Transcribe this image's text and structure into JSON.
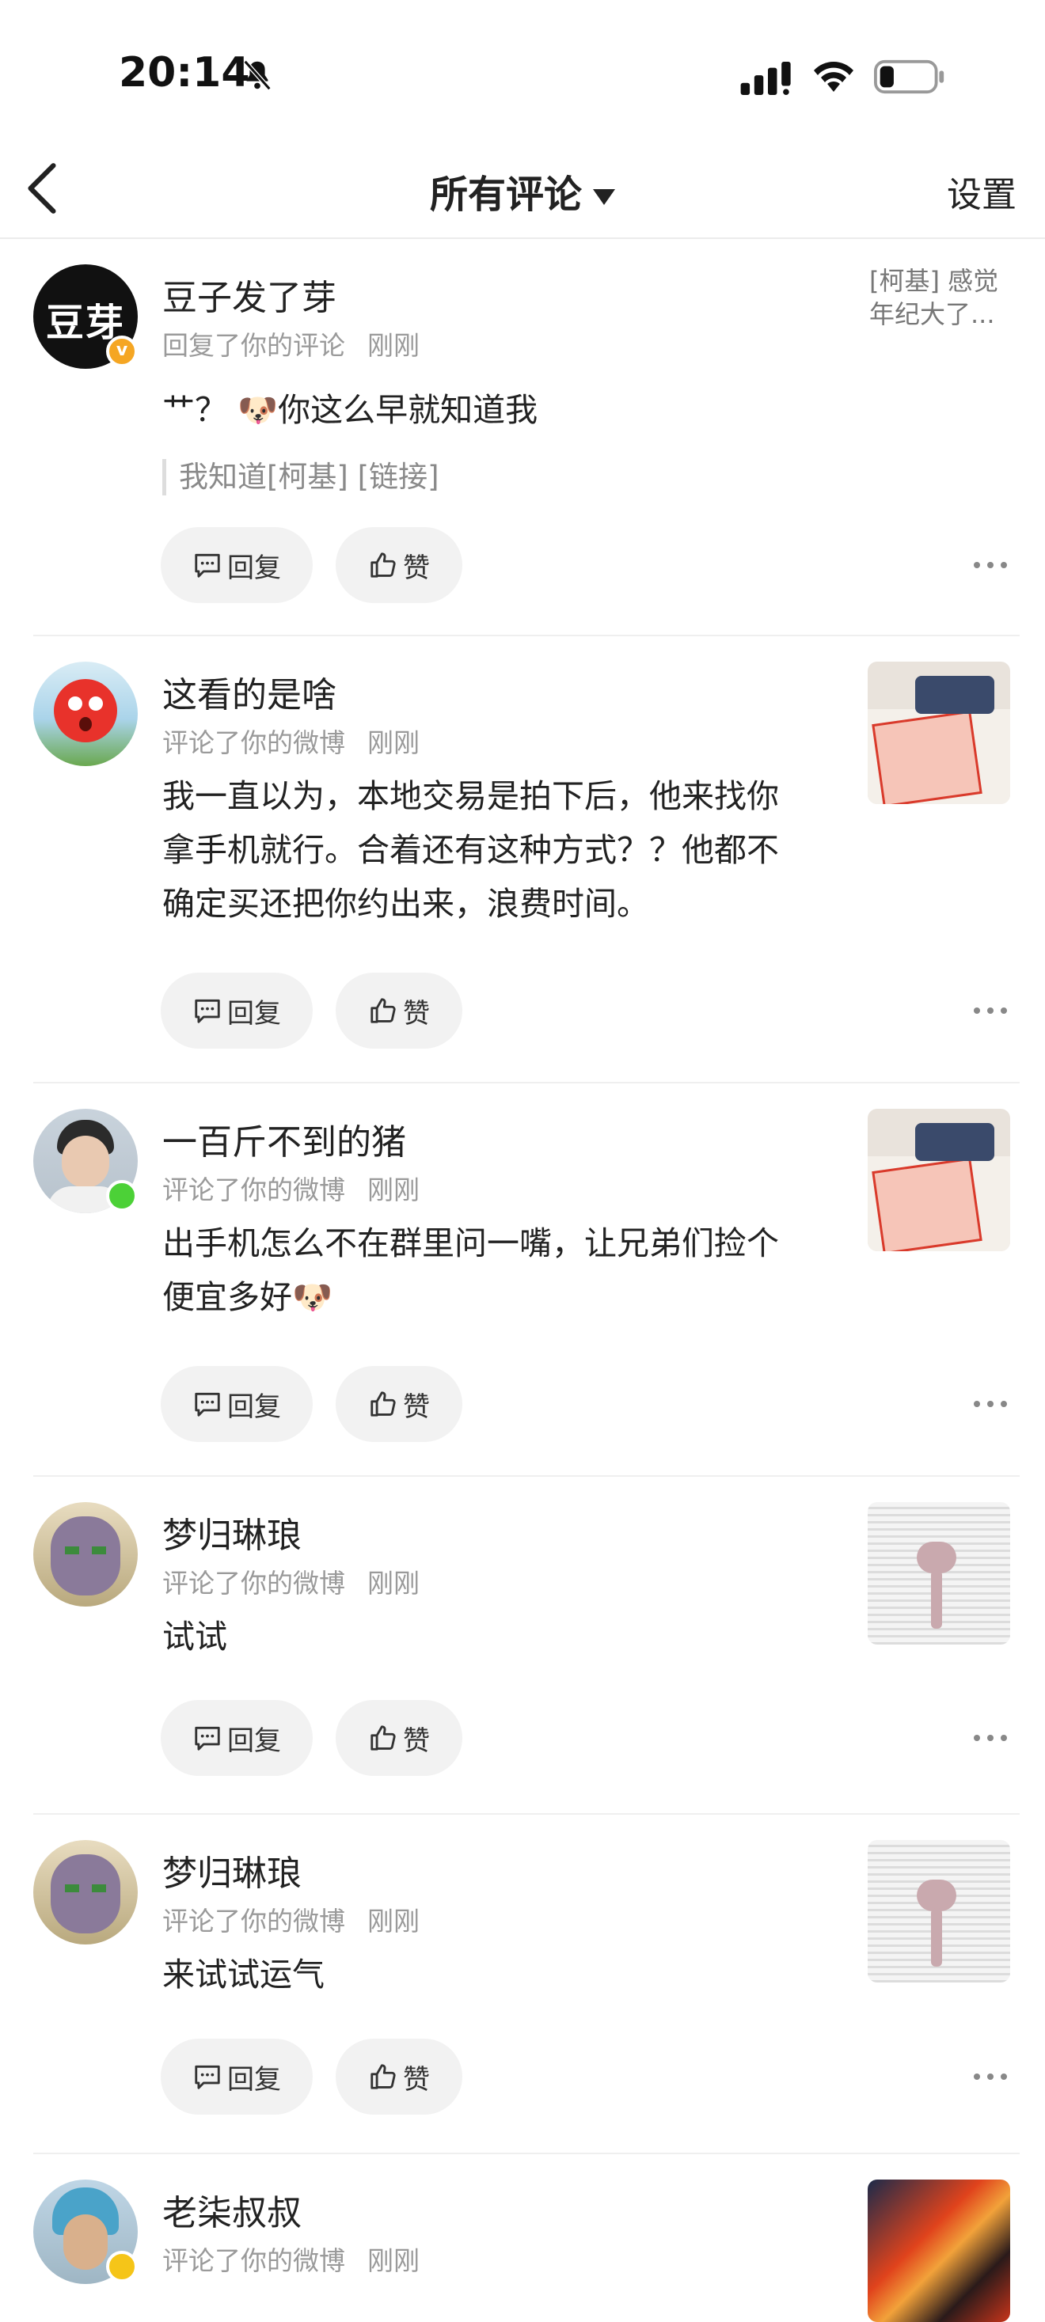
{
  "status_bar": {
    "time": "20:14",
    "icons": [
      "bell-muted-icon",
      "signal-icon",
      "wifi-icon",
      "battery-icon"
    ]
  },
  "nav": {
    "back_icon": "chevron-left-icon",
    "title": "所有评论",
    "dropdown_icon": "triangle-down-icon",
    "settings": "设置"
  },
  "actions": {
    "reply": "回复",
    "like": "赞"
  },
  "comments": [
    {
      "username": "豆子发了芽",
      "action": "回复了你的评论",
      "time": "刚刚",
      "text": "艹？ 🐶你这么早就知道我",
      "quote": "我知道[柯基] [链接]",
      "side_text": "[柯基] 感觉年纪大了...",
      "avatar_text": "豆芽",
      "badge": "v"
    },
    {
      "username": "这看的是啥",
      "action": "评论了你的微博",
      "time": "刚刚",
      "text": "我一直以为，本地交易是拍下后，他来找你拿手机就行。合着还有这种方式？？他都不确定买还把你约出来，浪费时间。"
    },
    {
      "username": "一百斤不到的猪",
      "action": "评论了你的微博",
      "time": "刚刚",
      "text": "出手机怎么不在群里问一嘴，让兄弟们捡个便宜多好🐶"
    },
    {
      "username": "梦归琳琅",
      "action": "评论了你的微博",
      "time": "刚刚",
      "text": "试试"
    },
    {
      "username": "梦归琳琅",
      "action": "评论了你的微博",
      "time": "刚刚",
      "text": "来试试运气"
    },
    {
      "username": "老柒叔叔",
      "action": "评论了你的微博",
      "time": "刚刚"
    }
  ],
  "colors": {
    "badge_orange": "#f5a623",
    "online_green": "#4cd137",
    "divider": "#efefef",
    "meta_gray": "#9a9a9a"
  }
}
